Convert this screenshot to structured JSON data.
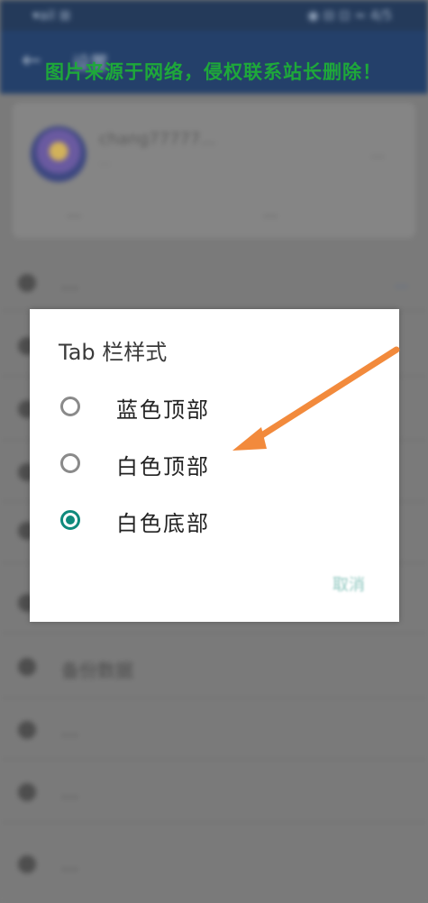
{
  "statusbar": {
    "left": "▾ail ⊞ ",
    "right": "◉ ⊟ ⊡ ≈ 4/5"
  },
  "appbar": {
    "back_icon": "arrow-back-icon",
    "title": "设置"
  },
  "account": {
    "name": "chang77777...",
    "sub": "...",
    "right": "...",
    "action1": "...",
    "action2": "..."
  },
  "background_sections": [
    {
      "label": "...",
      "link": "..."
    },
    {
      "label": "..."
    },
    {
      "label": "..."
    },
    {
      "label": "..."
    },
    {
      "label": "..."
    },
    {
      "label": "..."
    },
    {
      "label": "备份数据"
    },
    {
      "label": "..."
    },
    {
      "label": "..."
    },
    {
      "label": "..."
    }
  ],
  "dialog": {
    "title": "Tab 栏样式",
    "options": [
      {
        "label": "蓝色顶部",
        "selected": false
      },
      {
        "label": "白色顶部",
        "selected": false
      },
      {
        "label": "白色底部",
        "selected": true
      }
    ],
    "cancel_label": "取消",
    "accent_color": "#0f8a7c"
  },
  "watermark": "图片来源于网络，侵权联系站长删除！",
  "annotation": {
    "arrow_color": "#f28a3c",
    "icon": "pointer-arrow-icon"
  }
}
